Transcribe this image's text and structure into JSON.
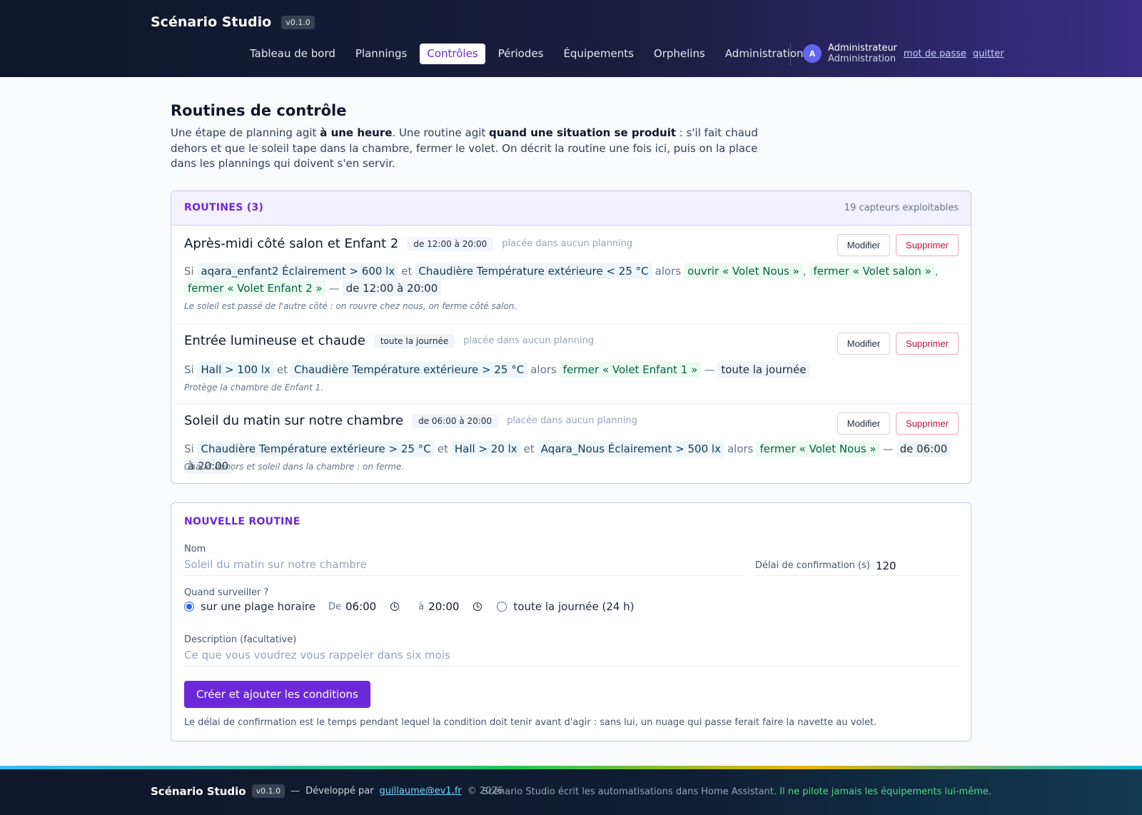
{
  "header": {
    "app_name": "Scénario Studio",
    "version": "v0.1.0",
    "nav": [
      {
        "label": "Tableau de bord",
        "active": false
      },
      {
        "label": "Plannings",
        "active": false
      },
      {
        "label": "Contrôles",
        "active": true
      },
      {
        "label": "Périodes",
        "active": false
      },
      {
        "label": "Équipements",
        "active": false
      },
      {
        "label": "Orphelins",
        "active": false
      },
      {
        "label": "Administration",
        "active": false
      }
    ],
    "user": {
      "avatar_initial": "A",
      "name": "Administrateur",
      "role": "Administration",
      "password_link": "mot de passe",
      "logout_link": "quitter"
    }
  },
  "page": {
    "title": "Routines de contrôle",
    "intro_1": "Une étape de planning agit ",
    "intro_b1": "à une heure",
    "intro_2": ". Une routine agit ",
    "intro_b2": "quand une situation se produit",
    "intro_3": " : s'il fait chaud dehors et que le soleil tape dans la chambre, fermer le volet. On décrit la routine une fois ici, puis on la place dans les plannings qui doivent s'en servir."
  },
  "routines": {
    "title": "ROUTINES (3)",
    "meta": "19 capteurs exploitables",
    "edit_label": "Modifier",
    "delete_label": "Supprimer",
    "word_if": "Si",
    "word_and": "et",
    "word_then": "alors",
    "dash": "—",
    "comma": ",",
    "items": [
      {
        "name": "Après-midi côté salon et Enfant 2",
        "window": "de 12:00 à 20:00",
        "placement": "placée dans aucun planning",
        "conditions": [
          "aqara_enfant2 Éclairement > 600 lx",
          "Chaudière Température extérieure < 25 °C"
        ],
        "actions": [
          "ouvrir « Volet Nous »",
          "fermer « Volet salon »",
          "fermer « Volet Enfant 2 »"
        ],
        "note": "Le soleil est passé de l'autre côté : on rouvre chez nous, on ferme côté salon."
      },
      {
        "name": "Entrée lumineuse et chaude",
        "window": "toute la journée",
        "placement": "placée dans aucun planning",
        "conditions": [
          "Hall > 100 lx",
          "Chaudière Température extérieure > 25 °C"
        ],
        "actions": [
          "fermer « Volet Enfant 1 »"
        ],
        "note": "Protège la chambre de Enfant 1."
      },
      {
        "name": "Soleil du matin sur notre chambre",
        "window": "de 06:00 à 20:00",
        "placement": "placée dans aucun planning",
        "conditions": [
          "Chaudière Température extérieure > 25 °C",
          "Hall > 20 lx",
          "Aqara_Nous Éclairement > 500 lx"
        ],
        "actions": [
          "fermer « Volet Nous »"
        ],
        "note": "Chaud dehors et soleil dans la chambre : on ferme."
      }
    ]
  },
  "form": {
    "title": "NOUVELLE ROUTINE",
    "name_label": "Nom",
    "name_placeholder": "Soleil du matin sur notre chambre",
    "delay_label": "Délai de confirmation (s)",
    "delay_value": "120",
    "when_label": "Quand surveiller ?",
    "option_range": "sur une plage horaire",
    "from_label": "De",
    "from_value": "06:00",
    "to_label": "à",
    "to_value": "20:00",
    "option_allday": "toute la journée (24 h)",
    "selected_option": "range",
    "desc_label": "Description (facultative)",
    "desc_placeholder": "Ce que vous voudrez vous rappeler dans six mois",
    "submit_label": "Créer et ajouter les conditions",
    "help_text": "Le délai de confirmation est le temps pendant lequel la condition doit tenir avant d'agir : sans lui, un nuage qui passe ferait faire la navette au volet."
  },
  "footer": {
    "app_name": "Scénario Studio",
    "version": "v0.1.0",
    "dash": "—",
    "dev_prefix": "Développé par",
    "dev_link": "guillaume@ev1.fr",
    "copyright": "© 2026",
    "right_text": "Scénario Studio écrit les automatisations dans Home Assistant.",
    "right_highlight": "Il ne pilote jamais les équipements lui-même."
  },
  "colors": {
    "accent": "#6d28d9",
    "header_bg_start": "#0f172a",
    "header_bg_end": "#3b2d88",
    "condition_chip": "#eef6fd",
    "action_chip": "#ecfbf1",
    "danger": "#be123c"
  },
  "icons": [
    "clock-icon",
    "radio-selected",
    "radio-unselected",
    "user-avatar"
  ]
}
